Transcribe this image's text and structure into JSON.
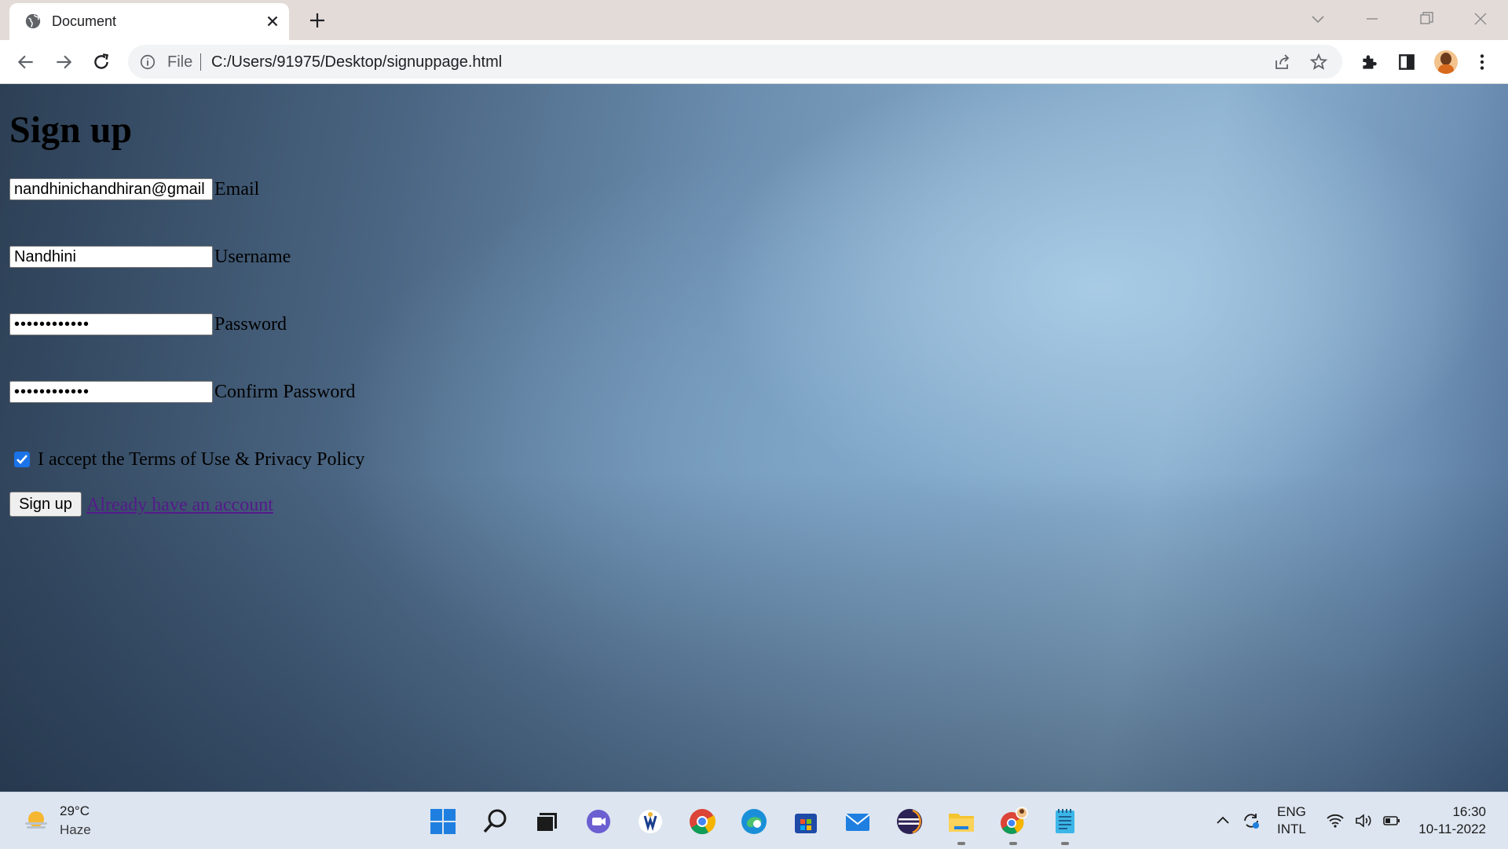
{
  "browser": {
    "tab_title": "Document",
    "address_scheme": "File",
    "address_url": "C:/Users/91975/Desktop/signuppage.html"
  },
  "page": {
    "heading": "Sign up",
    "fields": [
      {
        "label": "Email",
        "value": "nandhinichandhiran@gmail",
        "type": "text"
      },
      {
        "label": "Username",
        "value": "Nandhini",
        "type": "text"
      },
      {
        "label": "Password",
        "value": "••••••••••••",
        "type": "password"
      },
      {
        "label": "Confirm Password",
        "value": "••••••••••••",
        "type": "password"
      }
    ],
    "terms_label": "I accept the Terms of Use & Privacy Policy",
    "terms_checked": true,
    "submit_label": "Sign up",
    "login_link": "Already have an account"
  },
  "taskbar": {
    "weather_temp": "29°C",
    "weather_condition": "Haze",
    "lang_line1": "ENG",
    "lang_line2": "INTL",
    "time": "16:30",
    "date": "10-11-2022"
  },
  "colors": {
    "accent": "#1a73e8",
    "link_visited": "#551a8b"
  }
}
